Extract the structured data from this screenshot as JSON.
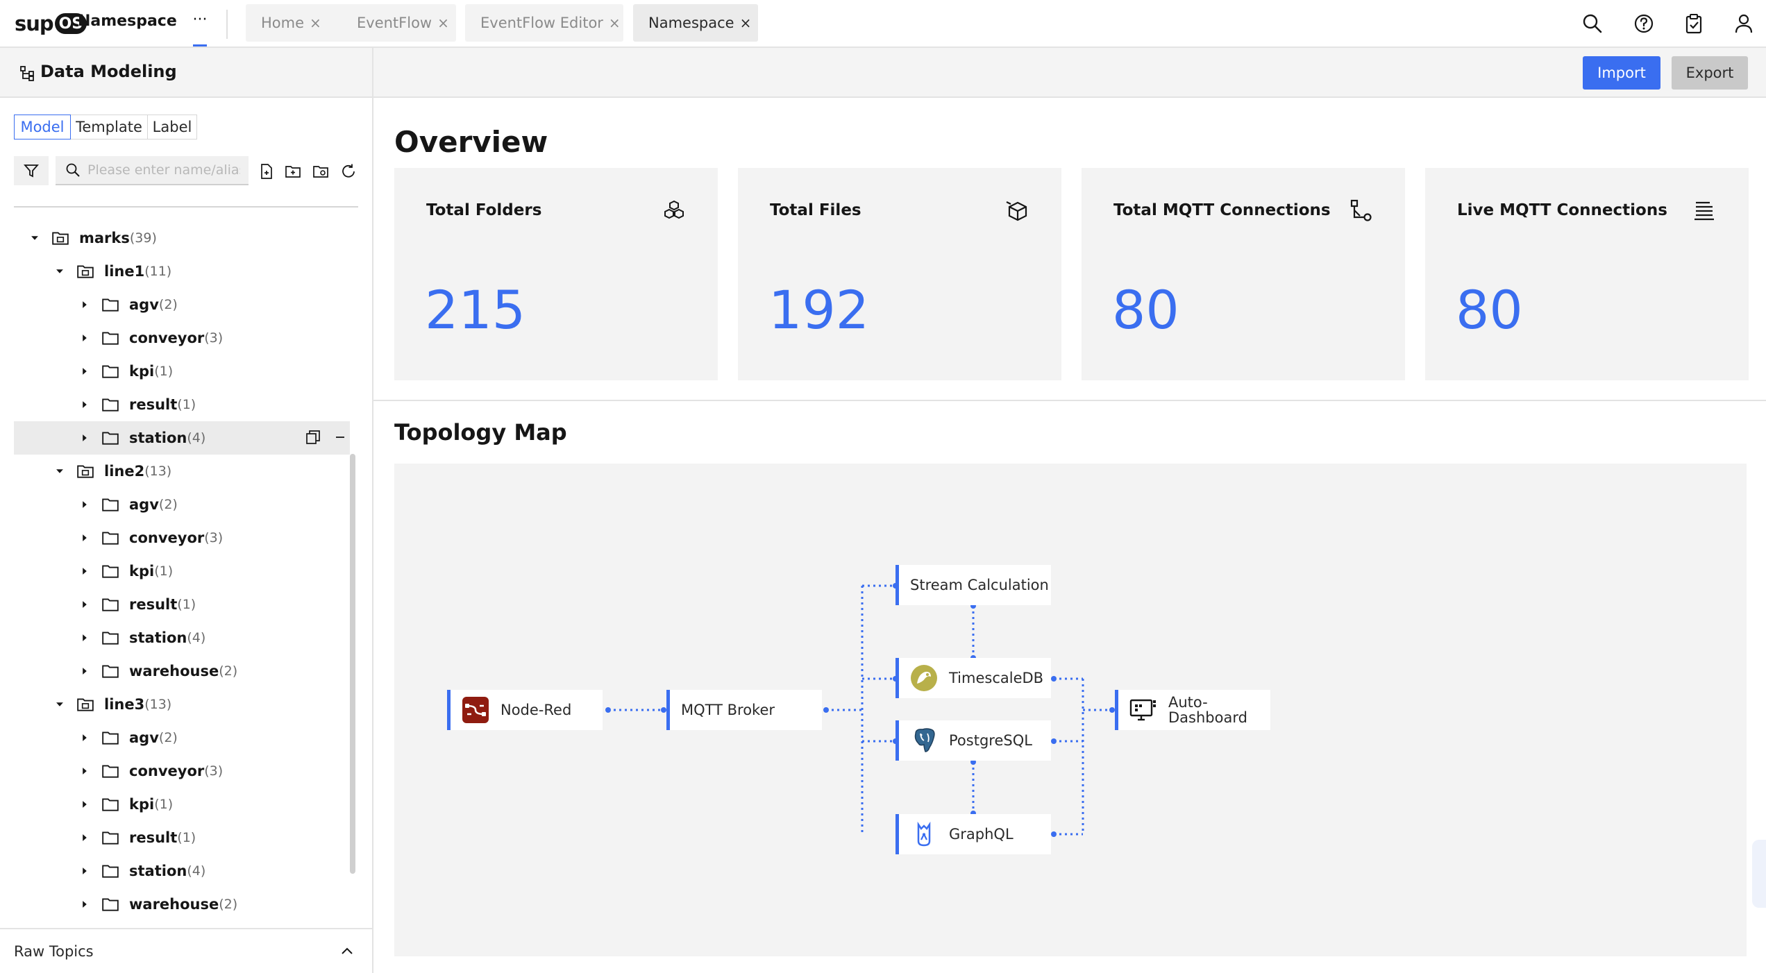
{
  "topbar": {
    "logo_prefix": "sup",
    "logo_badge": "OS",
    "app_name": "Namespace",
    "more": "···",
    "tabs": [
      {
        "label": "Home",
        "close": "×"
      },
      {
        "label": "EventFlow",
        "close": "×"
      },
      {
        "label": "EventFlow Editor",
        "close": "×"
      },
      {
        "label": "Namespace",
        "close": "×"
      }
    ],
    "icons": [
      "search-icon",
      "help-icon",
      "clipboard-icon",
      "user-icon"
    ]
  },
  "sidebar": {
    "title": "Data Modeling",
    "segments": [
      "Model",
      "Template",
      "Label"
    ],
    "search_placeholder": "Please enter name/alias",
    "tree": [
      {
        "label": "marks",
        "count": "(39)"
      },
      {
        "label": "line1",
        "count": "(11)"
      },
      {
        "label": "agv",
        "count": "(2)"
      },
      {
        "label": "conveyor",
        "count": "(3)"
      },
      {
        "label": "kpi",
        "count": "(1)"
      },
      {
        "label": "result",
        "count": "(1)"
      },
      {
        "label": "station",
        "count": "(4)"
      },
      {
        "label": "line2",
        "count": "(13)"
      },
      {
        "label": "agv",
        "count": "(2)"
      },
      {
        "label": "conveyor",
        "count": "(3)"
      },
      {
        "label": "kpi",
        "count": "(1)"
      },
      {
        "label": "result",
        "count": "(1)"
      },
      {
        "label": "station",
        "count": "(4)"
      },
      {
        "label": "warehouse",
        "count": "(2)"
      },
      {
        "label": "line3",
        "count": "(13)"
      },
      {
        "label": "agv",
        "count": "(2)"
      },
      {
        "label": "conveyor",
        "count": "(3)"
      },
      {
        "label": "kpi",
        "count": "(1)"
      },
      {
        "label": "result",
        "count": "(1)"
      },
      {
        "label": "station",
        "count": "(4)"
      },
      {
        "label": "warehouse",
        "count": "(2)"
      }
    ],
    "raw_topics": "Raw Topics"
  },
  "header": {
    "import_label": "Import",
    "export_label": "Export"
  },
  "overview": {
    "title": "Overview",
    "cards": [
      {
        "label": "Total Folders",
        "value": "215",
        "icon": "cubes-icon"
      },
      {
        "label": "Total Files",
        "value": "192",
        "icon": "box-icon"
      },
      {
        "label": "Total MQTT Connections",
        "value": "80",
        "icon": "connection-icon"
      },
      {
        "label": "Live MQTT Connections",
        "value": "80",
        "icon": "list-icon"
      }
    ]
  },
  "topology": {
    "title": "Topology Map",
    "nodes": {
      "nodered": "Node-Red",
      "mqtt": "MQTT Broker",
      "stream": "Stream Calculation",
      "timescale": "TimescaleDB",
      "postgres": "PostgreSQL",
      "graphql": "GraphQL",
      "dash_line1": "Auto-",
      "dash_line2": "Dashboard"
    }
  },
  "colors": {
    "accent": "#3a6ef0",
    "card_bg": "#f3f3f3",
    "nodered": "#8f1c10"
  }
}
